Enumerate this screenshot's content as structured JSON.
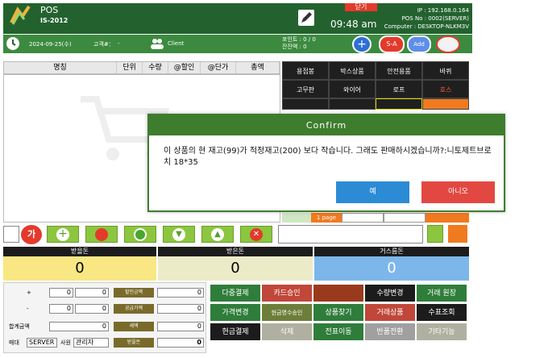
{
  "header": {
    "app_name": "POS",
    "app_sub": "IS-2012",
    "time": "09:48 am",
    "close_label": "닫기",
    "ip": "IP : 192.168.0.164",
    "pos_no": "POS No : 0002(SERVER)",
    "computer": "Computer : DESKTOP-NLKM3V"
  },
  "infobar": {
    "date": "2024-09-25(수)",
    "customer_label": "고객#：",
    "customer_value": "-",
    "client_label": "Client",
    "points": "포인트 : 0 / 0",
    "balance": "잔잔액 : 0",
    "sa_label": "S-A",
    "add_label": "Add"
  },
  "list": {
    "columns": [
      "명칭",
      "단위",
      "수량",
      "@할인",
      "@단가",
      "총액"
    ]
  },
  "categories": [
    "용접봉",
    "박스상품",
    "안전용품",
    "바퀴",
    "고무판",
    "와이어",
    "로프",
    "호스"
  ],
  "dialog": {
    "title": "Confirm",
    "message": "이 상품의 현 재고(99)가 적정재고(200) 보다 작습니다. 그래도 판매하시겠습니까?:니토제트브로치 18*35",
    "yes": "예",
    "no": "아니오"
  },
  "toolbar": {
    "ga": "가",
    "page": "1 page"
  },
  "money": {
    "receive_label": "받을돈",
    "receive_value": "0",
    "received_label": "받은돈",
    "received_value": "0",
    "change_label": "거스름돈",
    "change_value": "0"
  },
  "entry": {
    "plus": "+",
    "minus": "-",
    "total_label": "합계금액",
    "v1": "0",
    "v2": "0",
    "v3": "0",
    "v4": "0",
    "v5": "0",
    "discount_label": "할인금액",
    "supply_label": "공급가액",
    "tax_label": "세액",
    "receive_label": "받을돈",
    "d1": "0",
    "d2": "0",
    "d3": "0",
    "d4": "0",
    "store_label": "매대",
    "store_value": "SERVER",
    "staff_label": "사원",
    "staff_value": "관리자"
  },
  "actions": [
    "다중결제",
    "카드승인",
    "",
    "수량변경",
    "거래 원장",
    "가격변경",
    "현금영수승인",
    "상품찾기",
    "거래상품",
    "수표조회",
    "현금결제",
    "삭제",
    "전표이동",
    "반품전환",
    "기타기능"
  ]
}
